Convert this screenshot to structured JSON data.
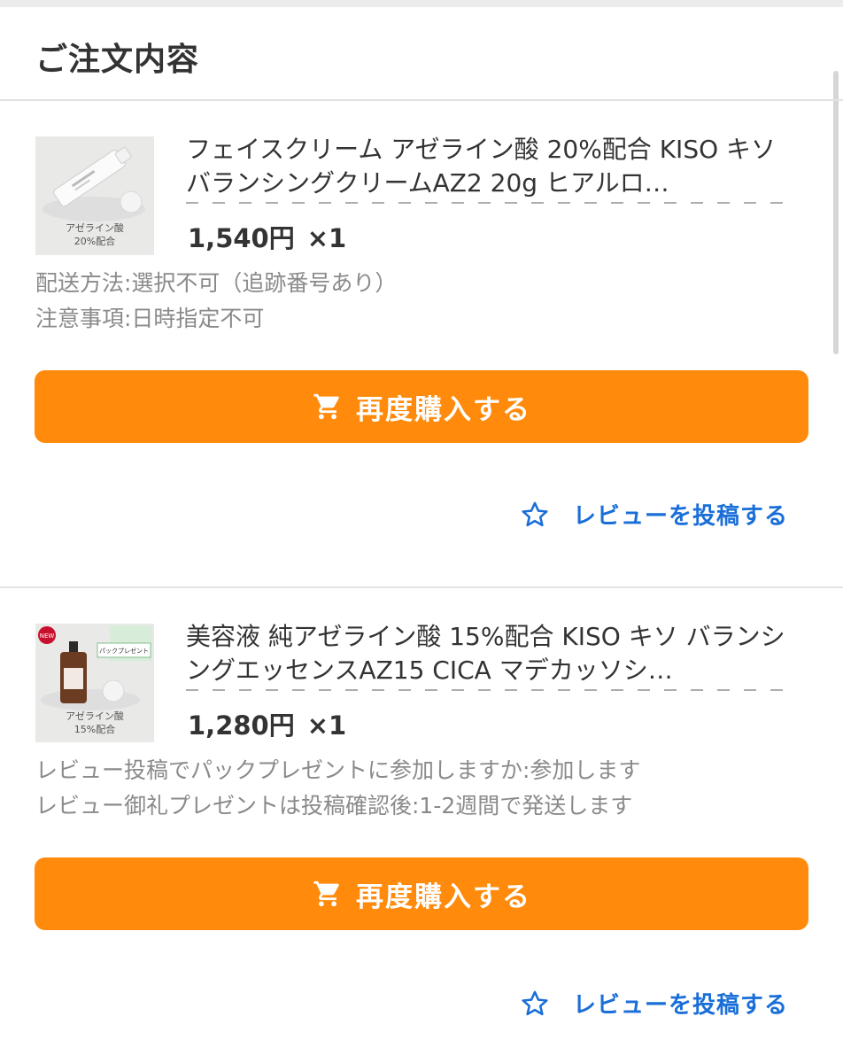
{
  "section": {
    "title": "ご注文内容"
  },
  "orders": [
    {
      "name": "フェイスクリーム アゼライン酸 20%配合 KISO キソ バランシングクリームAZ2 20g ヒアルロ…",
      "price": "1,540円",
      "quantity": "×1",
      "image_label": "アゼライン酸\n20%配合",
      "notes": [
        "配送方法:選択不可（追跡番号あり）",
        "注意事項:日時指定不可"
      ],
      "rebuy_label": "再度購入する",
      "review_label": "レビューを投稿する"
    },
    {
      "name": "美容液 純アゼライン酸 15%配合 KISO キソ バランシングエッセンスAZ15 CICA マデカッソシ…",
      "price": "1,280円",
      "quantity": "×1",
      "image_label": "アゼライン酸\n15%配合",
      "image_badge": "NEW",
      "image_banner": "パックプレゼント",
      "notes": [
        "レビュー投稿でパックプレゼントに参加しますか:参加します",
        "レビュー御礼プレゼントは投稿確認後:1-2週間で発送します"
      ],
      "rebuy_label": "再度購入する",
      "review_label": "レビューを投稿する"
    }
  ],
  "icons": {
    "cart": "cart-icon",
    "star": "star-outline-icon"
  },
  "colors": {
    "accent": "#ff8a0b",
    "link": "#1a6ed8",
    "muted": "#8a8a8a"
  }
}
